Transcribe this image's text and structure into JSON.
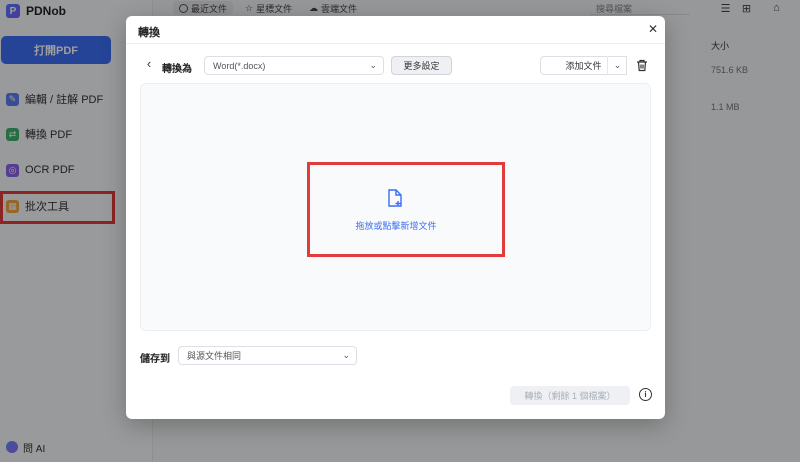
{
  "app": {
    "name": "PDNob",
    "open_pdf": "打開PDF",
    "sidebar": [
      {
        "label": "編輯 / 註解 PDF",
        "icon": "edit-icon"
      },
      {
        "label": "轉換 PDF",
        "icon": "convert-icon"
      },
      {
        "label": "OCR PDF",
        "icon": "ocr-icon"
      },
      {
        "label": "批次工具",
        "icon": "batch-tools-icon"
      }
    ],
    "ai_label": "問 AI",
    "tabs": [
      {
        "label": "最近文件",
        "icon": "clock-icon"
      },
      {
        "label": "星標文件",
        "icon": "star-icon"
      },
      {
        "label": "雲端文件",
        "icon": "cloud-icon"
      }
    ],
    "search_placeholder": "搜尋檔案",
    "size_header": "大小",
    "file_sizes": [
      "751.6 KB",
      "1.1 MB"
    ]
  },
  "dialog": {
    "title": "轉換",
    "convert_to_label": "轉換為",
    "format_value": "Word(*.docx)",
    "more_settings": "更多設定",
    "add_file": "添加文件",
    "drop_text": "拖放或點擊新增文件",
    "save_to_label": "儲存到",
    "save_value": "與源文件相同",
    "convert_button": "轉換（剩餘 1 個檔案）"
  },
  "colors": {
    "accent": "#3d6ef5",
    "highlight": "#e23b3b"
  }
}
